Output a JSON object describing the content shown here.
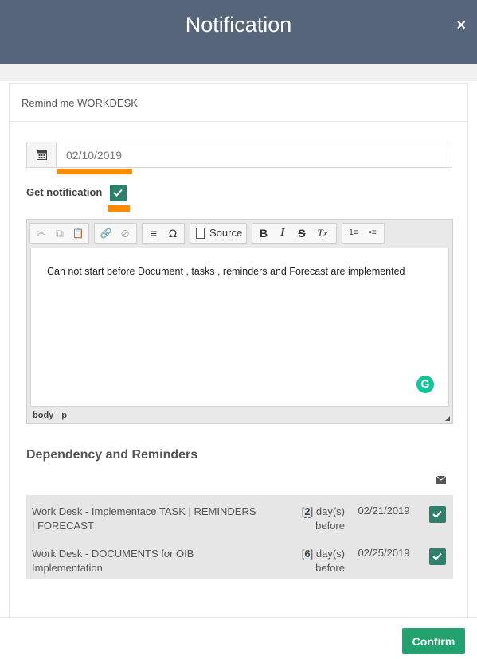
{
  "modal": {
    "title": "Notification",
    "close_label": "×"
  },
  "panel": {
    "heading": "Remind me WORKDESK"
  },
  "date_field": {
    "value": "02/10/2019",
    "icon": "calendar-icon"
  },
  "get_notification": {
    "label": "Get notification",
    "checked": true
  },
  "editor": {
    "toolbar": {
      "cut": "✂",
      "copy": "⧉",
      "paste": "📋",
      "link": "🔗",
      "unlink": "⊘",
      "hr": "≡",
      "special_char": "Ω",
      "source": "Source",
      "bold": "B",
      "italic": "I",
      "strike": "S",
      "remove_format": "Tx",
      "numbered_list": "1≡",
      "bullet_list": "•≡"
    },
    "content": "Can not start before Document , tasks , reminders and Forecast are implemented",
    "path": [
      "body",
      "p"
    ],
    "grammarly": "G"
  },
  "dependencies": {
    "title": "Dependency and Reminders",
    "rows": [
      {
        "name_line1": "Work Desk - Implementace TASK | REMINDERS",
        "name_line2": "| FORECAST",
        "days": "2",
        "days_unit": "day(s)",
        "days_suffix": "before",
        "date": "02/21/2019",
        "checked": true
      },
      {
        "name_line1": "Work Desk - DOCUMENTS for OIB",
        "name_line2": "Implementation",
        "days": "6",
        "days_unit": "day(s)",
        "days_suffix": "before",
        "date": "02/25/2019",
        "checked": true
      }
    ]
  },
  "footer": {
    "confirm_label": "Confirm"
  },
  "colors": {
    "header": "#56657a",
    "confirm": "#23a16f",
    "check": "#2f7f6b",
    "highlight": "#ff8c00"
  }
}
